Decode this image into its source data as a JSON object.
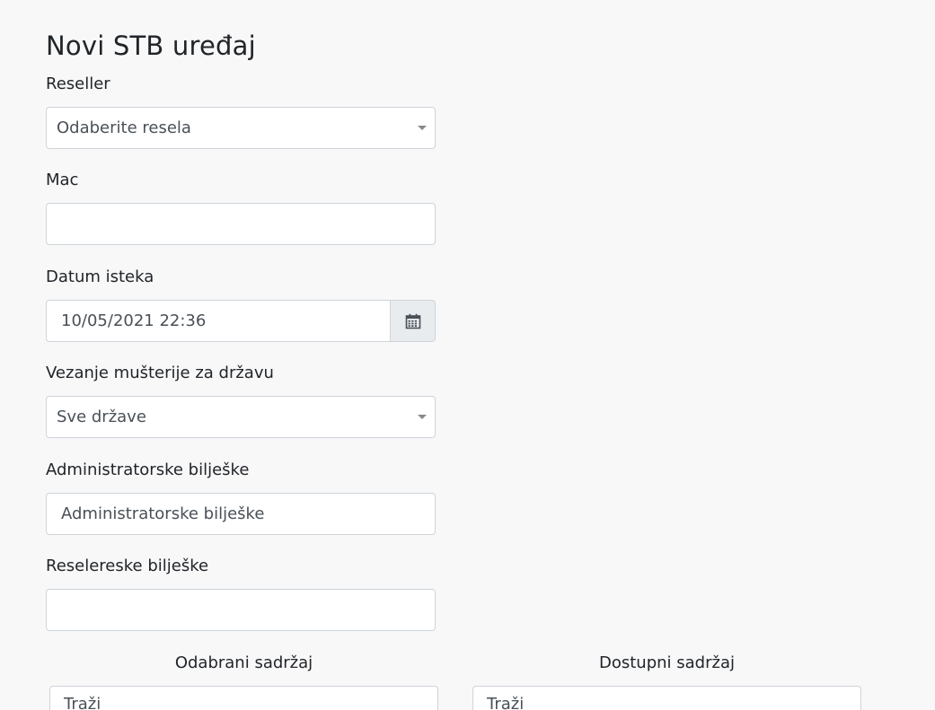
{
  "form": {
    "title": "Novi STB uređaj",
    "reseller": {
      "label": "Reseller",
      "selected": "Odaberite resela"
    },
    "mac": {
      "label": "Mac",
      "value": ""
    },
    "expiry": {
      "label": "Datum isteka",
      "value": "10/05/2021 22:36",
      "icon": "calendar-icon"
    },
    "country": {
      "label": "Vezanje mušterije za državu",
      "selected": "Sve države"
    },
    "admin_notes": {
      "label": "Administratorske bilješke",
      "placeholder": "Administratorske bilješke",
      "value": ""
    },
    "reseller_notes": {
      "label": "Reselereske bilješke",
      "value": ""
    }
  },
  "content": {
    "selected": {
      "heading": "Odabrani sadržaj",
      "search_placeholder": "Traži"
    },
    "available": {
      "heading": "Dostupni sadržaj",
      "search_placeholder": "Traži"
    }
  },
  "colors": {
    "background": "#f8f8f9",
    "border": "#ced4da",
    "addon": "#e9ecef",
    "text": "#212529"
  }
}
